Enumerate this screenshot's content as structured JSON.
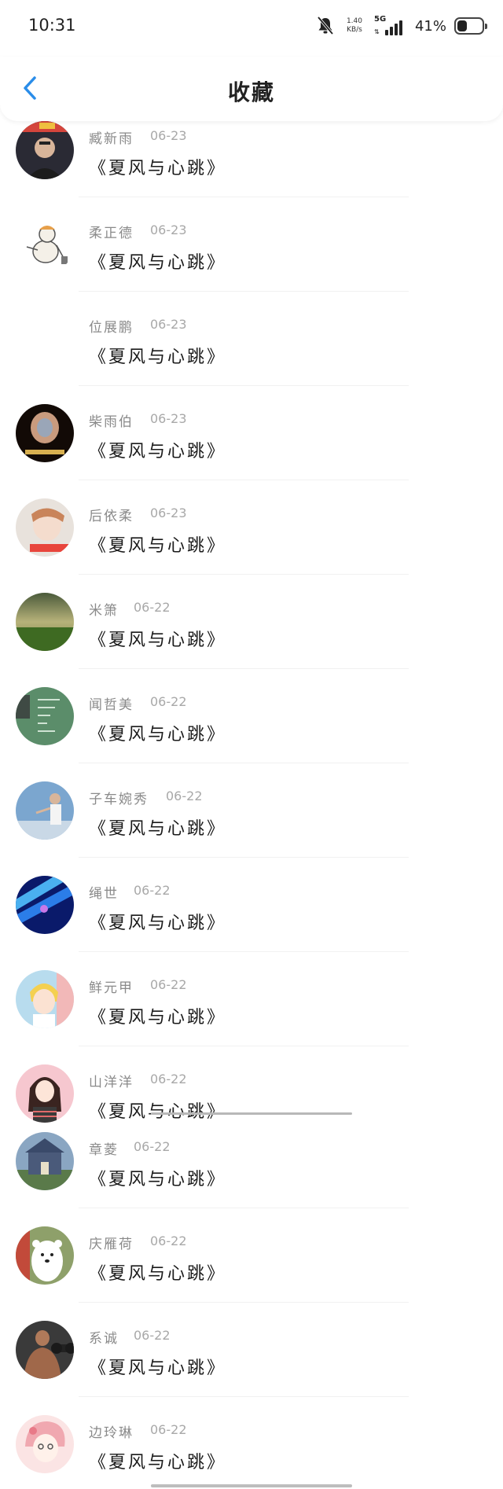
{
  "status": {
    "time": "10:31",
    "net_speed_value": "1.40",
    "net_speed_unit": "KB/s",
    "network": "5G",
    "battery_percent": "41%",
    "battery_level": 0.41
  },
  "header": {
    "title": "收藏",
    "back_icon": "chevron-left-icon",
    "accent": "#2a8de9"
  },
  "favorites": [
    {
      "name": "臧新雨",
      "date": "06-23",
      "title": "《夏风与心跳》"
    },
    {
      "name": "柔正德",
      "date": "06-23",
      "title": "《夏风与心跳》"
    },
    {
      "name": "位展鹏",
      "date": "06-23",
      "title": "《夏风与心跳》"
    },
    {
      "name": "柴雨伯",
      "date": "06-23",
      "title": "《夏风与心跳》"
    },
    {
      "name": "后依柔",
      "date": "06-23",
      "title": "《夏风与心跳》"
    },
    {
      "name": "米箫",
      "date": "06-22",
      "title": "《夏风与心跳》"
    },
    {
      "name": "闻哲美",
      "date": "06-22",
      "title": "《夏风与心跳》"
    },
    {
      "name": "子车婉秀",
      "date": "06-22",
      "title": "《夏风与心跳》"
    },
    {
      "name": "绳世",
      "date": "06-22",
      "title": "《夏风与心跳》"
    },
    {
      "name": "鲜元甲",
      "date": "06-22",
      "title": "《夏风与心跳》"
    },
    {
      "name": "山洋洋",
      "date": "06-22",
      "title": "《夏风与心跳》"
    },
    {
      "name": "章菱",
      "date": "06-22",
      "title": "《夏风与心跳》"
    },
    {
      "name": "庆雁荷",
      "date": "06-22",
      "title": "《夏风与心跳》"
    },
    {
      "name": "系诚",
      "date": "06-22",
      "title": "《夏风与心跳》"
    },
    {
      "name": "边玲琳",
      "date": "06-22",
      "title": "《夏风与心跳》"
    }
  ]
}
